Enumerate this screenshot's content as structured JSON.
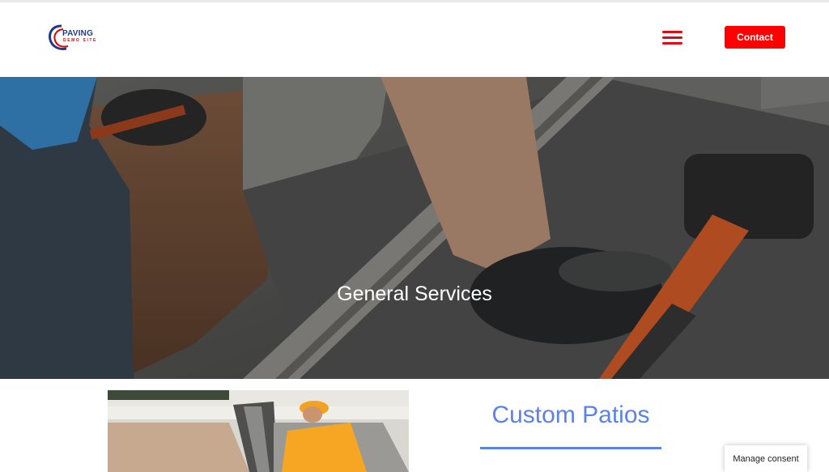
{
  "header": {
    "logo_word_top": "PAVING",
    "logo_word_bottom": "DEMO SITE",
    "menu_icon": "hamburger-menu-icon",
    "contact_label": "Contact"
  },
  "hero": {
    "title": "General Services"
  },
  "service": {
    "title": "Custom Patios"
  },
  "consent": {
    "label": "Manage consent"
  },
  "colors": {
    "brand_red": "#ff0000",
    "menu_red": "#e30613",
    "accent_blue": "#5b82e6",
    "logo_navy": "#1f3a8a"
  }
}
